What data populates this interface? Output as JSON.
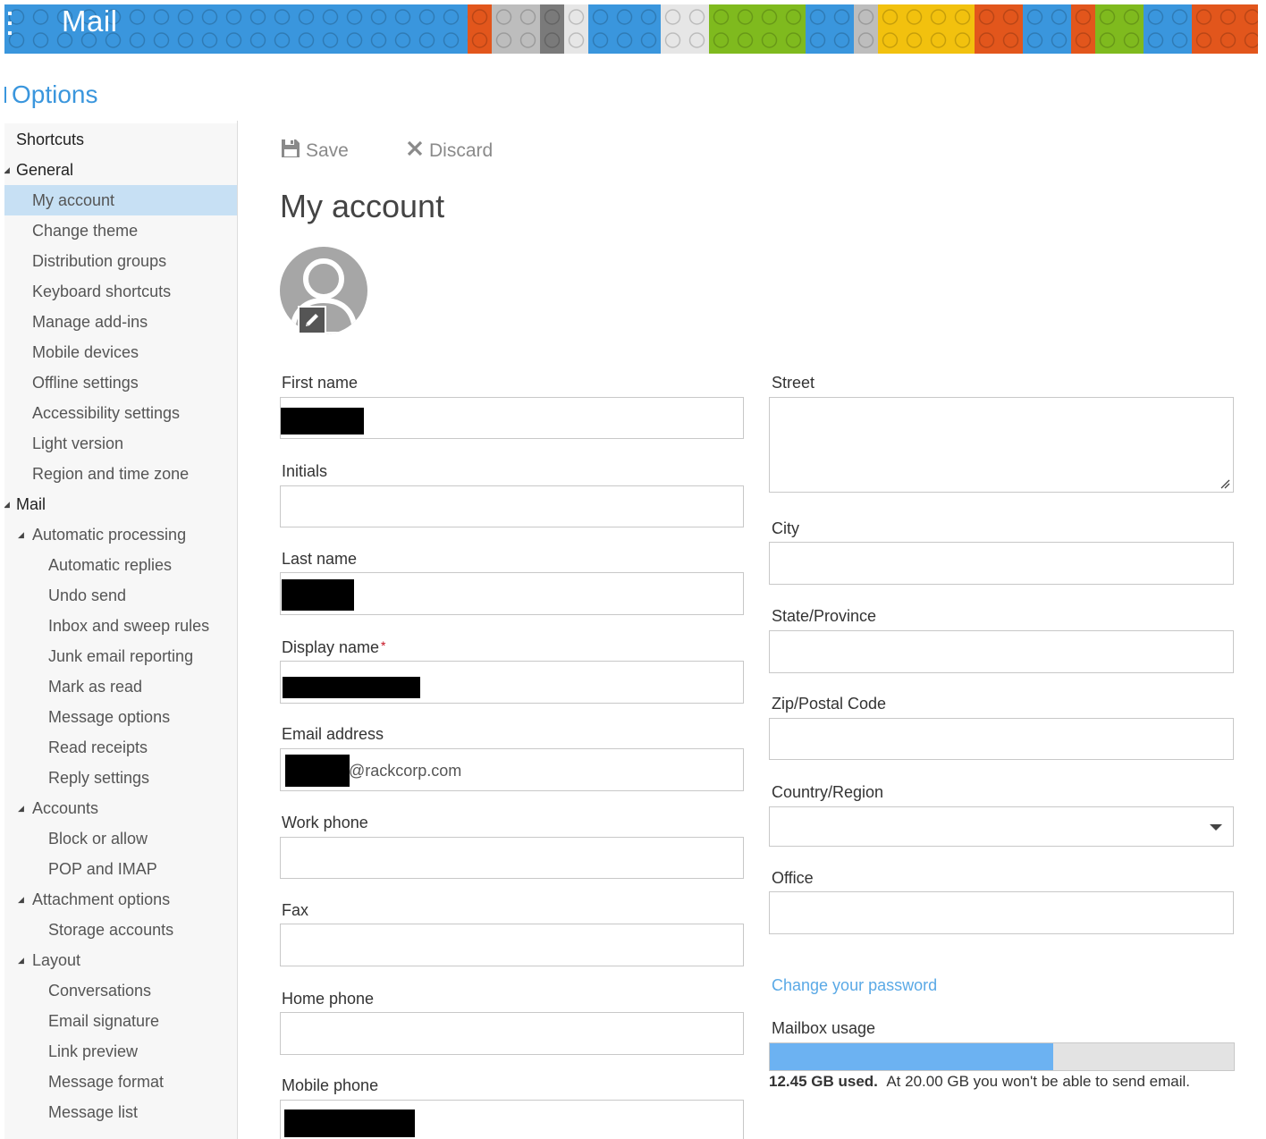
{
  "app": {
    "title": "Mail"
  },
  "options_title": "Options",
  "sidebar": {
    "items": [
      {
        "label": "Shortcuts",
        "level": 0,
        "expandable": false
      },
      {
        "label": "General",
        "level": 0,
        "expandable": true
      },
      {
        "label": "My account",
        "level": 1,
        "selected": true
      },
      {
        "label": "Change theme",
        "level": 1
      },
      {
        "label": "Distribution groups",
        "level": 1
      },
      {
        "label": "Keyboard shortcuts",
        "level": 1
      },
      {
        "label": "Manage add-ins",
        "level": 1
      },
      {
        "label": "Mobile devices",
        "level": 1
      },
      {
        "label": "Offline settings",
        "level": 1
      },
      {
        "label": "Accessibility settings",
        "level": 1
      },
      {
        "label": "Light version",
        "level": 1
      },
      {
        "label": "Region and time zone",
        "level": 1
      },
      {
        "label": "Mail",
        "level": 0,
        "expandable": true
      },
      {
        "label": "Automatic processing",
        "level": 1,
        "expandable": true
      },
      {
        "label": "Automatic replies",
        "level": 2
      },
      {
        "label": "Undo send",
        "level": 2
      },
      {
        "label": "Inbox and sweep rules",
        "level": 2
      },
      {
        "label": "Junk email reporting",
        "level": 2
      },
      {
        "label": "Mark as read",
        "level": 2
      },
      {
        "label": "Message options",
        "level": 2
      },
      {
        "label": "Read receipts",
        "level": 2
      },
      {
        "label": "Reply settings",
        "level": 2
      },
      {
        "label": "Accounts",
        "level": 1,
        "expandable": true
      },
      {
        "label": "Block or allow",
        "level": 2
      },
      {
        "label": "POP and IMAP",
        "level": 2
      },
      {
        "label": "Attachment options",
        "level": 1,
        "expandable": true
      },
      {
        "label": "Storage accounts",
        "level": 2
      },
      {
        "label": "Layout",
        "level": 1,
        "expandable": true
      },
      {
        "label": "Conversations",
        "level": 2
      },
      {
        "label": "Email signature",
        "level": 2
      },
      {
        "label": "Link preview",
        "level": 2
      },
      {
        "label": "Message format",
        "level": 2
      },
      {
        "label": "Message list",
        "level": 2
      }
    ]
  },
  "toolbar": {
    "save_label": "Save",
    "discard_label": "Discard",
    "save_icon": "save-disk-icon",
    "discard_icon": "close-x-icon"
  },
  "page": {
    "title": "My account"
  },
  "form": {
    "first_name": {
      "label": "First name",
      "value": "",
      "redacted": true
    },
    "initials": {
      "label": "Initials",
      "value": ""
    },
    "last_name": {
      "label": "Last name",
      "value": "",
      "redacted": true
    },
    "display_name": {
      "label": "Display name",
      "required_marker": "*",
      "value": "",
      "redacted": true
    },
    "email": {
      "label": "Email address",
      "value_suffix": "@rackcorp.com",
      "redacted": true
    },
    "work_phone": {
      "label": "Work phone",
      "value": ""
    },
    "fax": {
      "label": "Fax",
      "value": ""
    },
    "home_phone": {
      "label": "Home phone",
      "value": ""
    },
    "mobile_phone": {
      "label": "Mobile phone",
      "value": "",
      "redacted": true
    },
    "street": {
      "label": "Street",
      "value": ""
    },
    "city": {
      "label": "City",
      "value": ""
    },
    "state": {
      "label": "State/Province",
      "value": ""
    },
    "zip": {
      "label": "Zip/Postal Code",
      "value": ""
    },
    "country": {
      "label": "Country/Region",
      "value": ""
    },
    "office": {
      "label": "Office",
      "value": ""
    }
  },
  "change_password_link": "Change your password",
  "mailbox": {
    "label": "Mailbox usage",
    "used_text": "12.45 GB used.",
    "limit_text": "At 20.00 GB you won't be able to send email.",
    "used_gb": 12.45,
    "limit_gb": 20.0,
    "bar_fill_fraction": 0.61
  },
  "colors": {
    "accent": "#3a96dd",
    "selected_bg": "#c7e0f4",
    "link": "#5aa9e6",
    "usage_fill": "#6cb2f2",
    "brick_palette": [
      "#e2561c",
      "#bdbdbd",
      "#7a7a7a",
      "#e6e6e6",
      "#3a96dd",
      "#7fba1e",
      "#f2c10e",
      "#606060"
    ]
  }
}
